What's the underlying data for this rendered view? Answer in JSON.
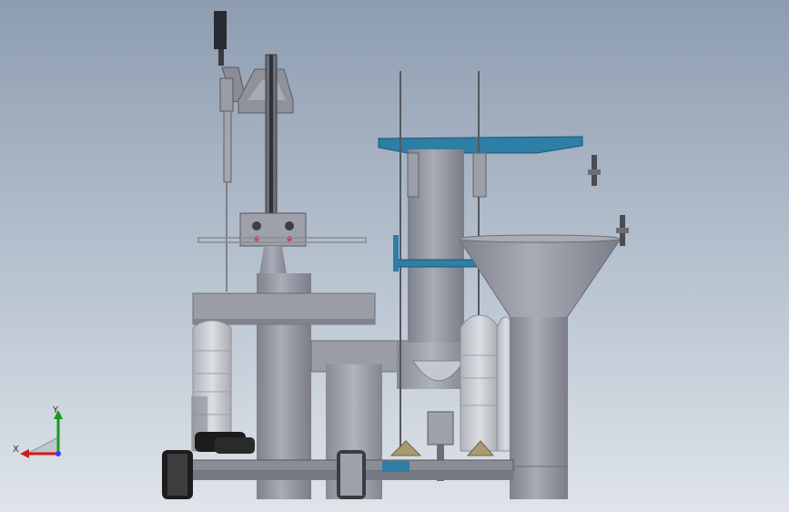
{
  "viewport": {
    "background_top": "#8d9cb0",
    "background_bottom": "#dfe4ea"
  },
  "triad": {
    "x_label": "X",
    "y_label": "Y",
    "x_color": "#d11a1a",
    "y_color": "#1a9a1a"
  },
  "colors": {
    "metal": "#8e919c",
    "metal_light": "#a7aab4",
    "metal_dark": "#6c6f7a",
    "platform_blue": "#2e7ea5",
    "bottle": "#c6c8cf",
    "black": "#1c1c1c"
  }
}
